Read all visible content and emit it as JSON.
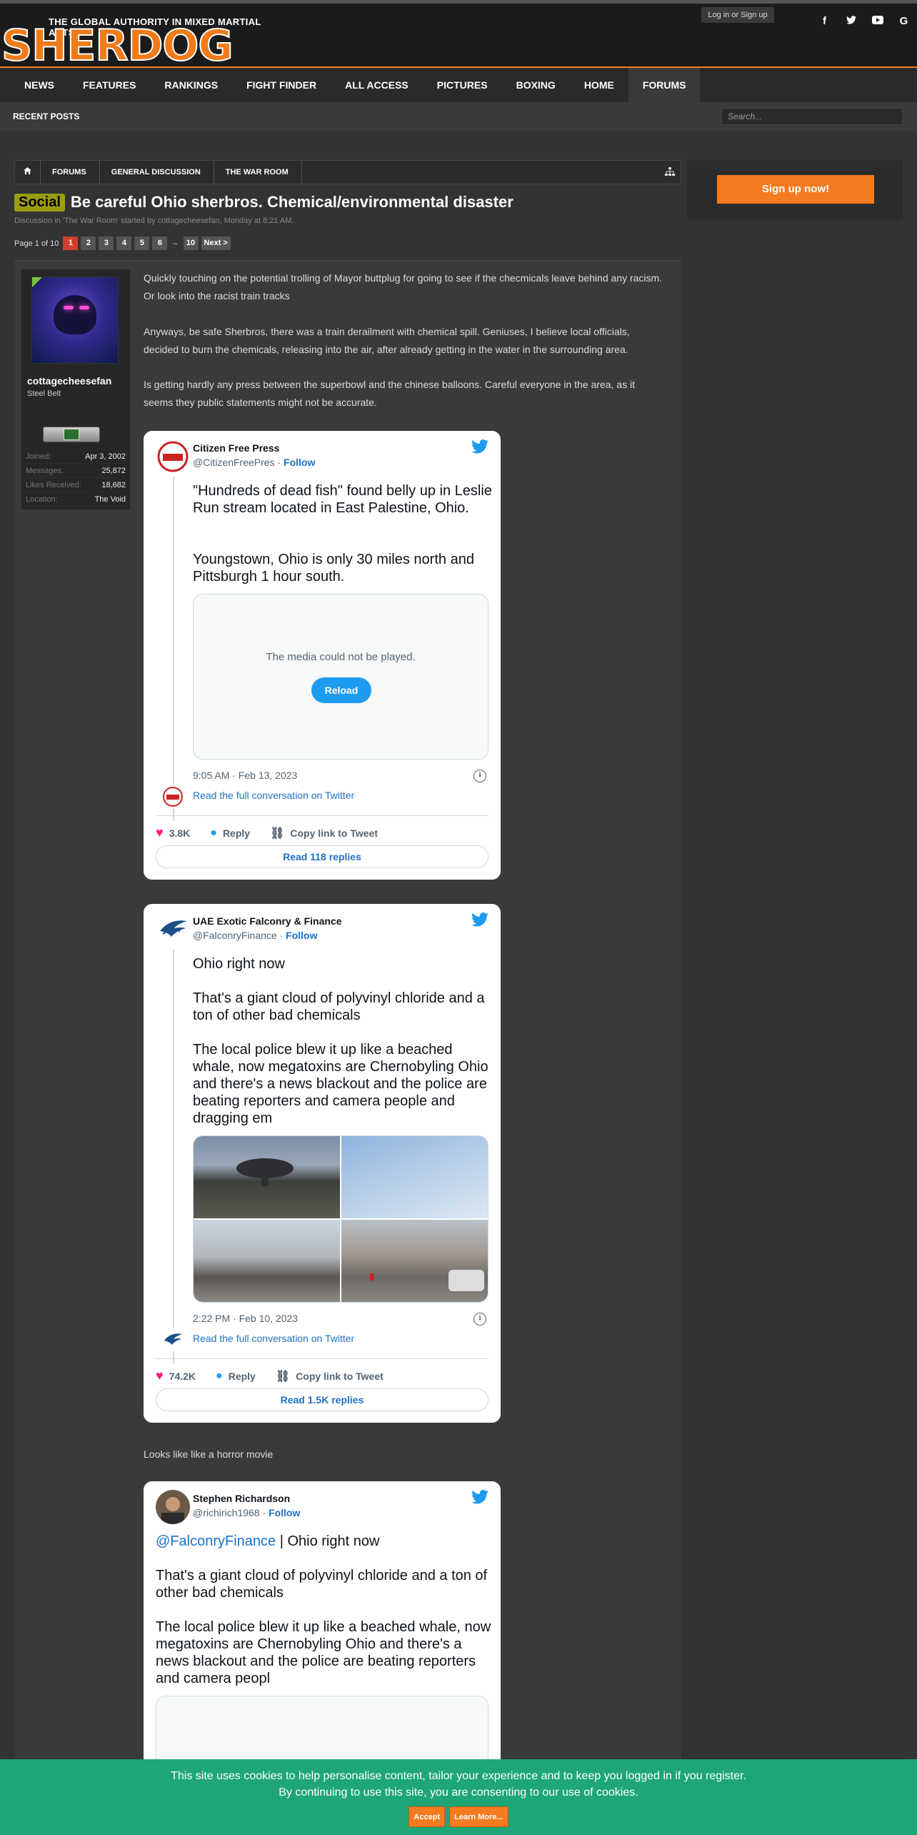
{
  "site": {
    "tagline": "THE GLOBAL AUTHORITY IN MIXED MARTIAL ARTS",
    "logo_word": "SHERDOG",
    "login_label": "Log in or Sign up",
    "social_icons": [
      "facebook-icon",
      "twitter-icon",
      "youtube-icon",
      "google-icon"
    ]
  },
  "nav": {
    "items": [
      "NEWS",
      "FEATURES",
      "RANKINGS",
      "FIGHT FINDER",
      "ALL ACCESS",
      "PICTURES",
      "BOXING",
      "HOME",
      "FORUMS"
    ],
    "active": "FORUMS",
    "recent_posts": "RECENT POSTS",
    "search_placeholder": "Search..."
  },
  "breadcrumb": [
    "FORUMS",
    "GENERAL DISCUSSION",
    "THE WAR ROOM"
  ],
  "thread": {
    "prefix": "Social",
    "title": "Be careful Ohio sherbros. Chemical/environmental disaster",
    "meta": "Discussion in 'The War Room' started by cottagecheesefan, Monday at 8:21 AM."
  },
  "pagination": {
    "label": "Page 1 of 10",
    "pages": [
      "1",
      "2",
      "3",
      "4",
      "5",
      "6"
    ],
    "current": "1",
    "dash": "–",
    "last": "10",
    "next": "Next >"
  },
  "sidebar": {
    "signup_label": "Sign up now!"
  },
  "user": {
    "name": "cottagecheesefan",
    "title": "Steel Belt",
    "stats": [
      {
        "k": "Joined:",
        "v": "Apr 3, 2002"
      },
      {
        "k": "Messages:",
        "v": "25,872"
      },
      {
        "k": "Likes Received:",
        "v": "18,682"
      },
      {
        "k": "Location:",
        "v": "The Void"
      }
    ]
  },
  "post": {
    "p1": "Quickly touching on the potential trolling of Mayor buttplug for going to see if the checmicals leave behind any racism. Or look into the racist train tracks",
    "p2": "Anyways, be safe Sherbros, there was a train derailment with chemical spill. Geniuses, I believe local officials, decided to burn the chemicals, releasing into the air, after already getting in the water in the surrounding area.",
    "p3": "Is getting hardly any press between the superbowl and the chinese balloons. Careful everyone in the area, as it seems they public statements might not be accurate.",
    "between": "Looks like like a horror movie"
  },
  "tweets": [
    {
      "name": "Citizen Free Press",
      "handle": "@CitizenFreePres",
      "follow": "Follow",
      "text1": "\"Hundreds of dead fish\" found belly up in Leslie Run stream located in East Palestine, Ohio.",
      "text2": "Youngstown, Ohio is only 30 miles north and Pittsburgh 1 hour south.",
      "media_msg": "The media could not be played.",
      "reload": "Reload",
      "time": "9:05 AM · Feb 13, 2023",
      "conv": "Read the full conversation on Twitter",
      "likes": "3.8K",
      "reply": "Reply",
      "copy": "Copy link to Tweet",
      "replies": "Read 118 replies"
    },
    {
      "name": "UAE Exotic Falconry & Finance",
      "handle": "@FalconryFinance",
      "follow": "Follow",
      "text1": "Ohio right now",
      "text2": "That's a giant cloud of polyvinyl chloride and a ton of other bad chemicals",
      "text3": "The local police blew it up like a beached whale, now megatoxins are Chernobyling Ohio and there's a news blackout and the police are beating reporters and camera people and dragging em",
      "time": "2:22 PM · Feb 10, 2023",
      "conv": "Read the full conversation on Twitter",
      "likes": "74.2K",
      "reply": "Reply",
      "copy": "Copy link to Tweet",
      "replies": "Read 1.5K replies"
    },
    {
      "name": "Stephen Richardson",
      "handle": "@richirich1968",
      "follow": "Follow",
      "mention": "@FalconryFinance",
      "text1": " | Ohio right now",
      "text2": "That's a giant cloud of polyvinyl chloride and a ton of other bad chemicals",
      "text3": "The local police blew it up like a beached whale, now megatoxins are Chernobyling Ohio and there's a news blackout and the police are beating reporters and camera peopl"
    }
  ],
  "cookie": {
    "line1": "This site uses cookies to help personalise content, tailor your experience and to keep you logged in if you register.",
    "line2": "By continuing to use this site, you are consenting to our use of cookies.",
    "accept": "Accept",
    "learn": "Learn More..."
  },
  "colors": {
    "accent": "#f47b20",
    "twitter": "#1d9bf0",
    "cookie_bg": "#1ea678",
    "prefix": "#9a9d12"
  }
}
